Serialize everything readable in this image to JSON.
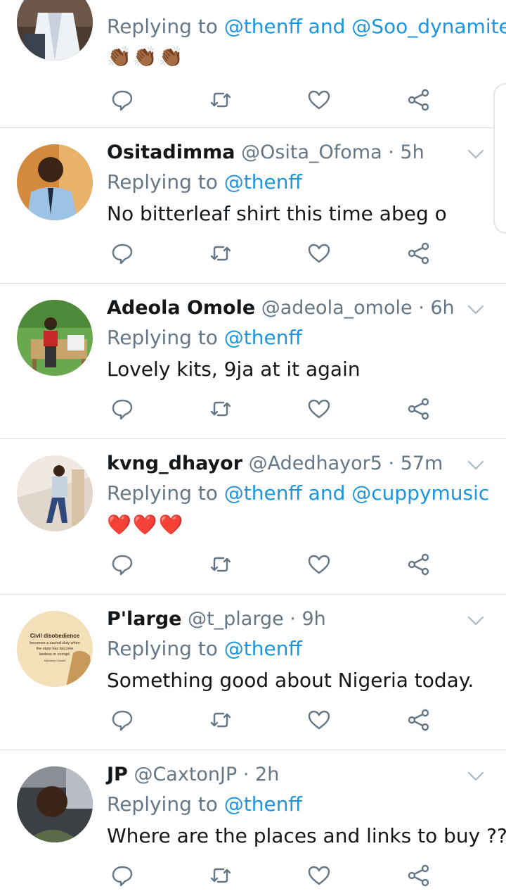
{
  "tweets": [
    {
      "name": "",
      "handle": "",
      "time": "",
      "reply_prefix": "Replying to",
      "mentions": [
        "@thenff",
        "and",
        "@Soo_dynamite"
      ],
      "body": "👏🏾👏🏾👏🏾",
      "is_emoji": true
    },
    {
      "name": "Ositadimma",
      "handle": "@Osita_Ofoma",
      "time": "· 5h",
      "reply_prefix": "Replying to",
      "mentions": [
        "@thenff"
      ],
      "body": "No bitterleaf shirt this time abeg o",
      "is_emoji": false
    },
    {
      "name": "Adeola Omole",
      "handle": "@adeola_omole",
      "time": "· 6h",
      "reply_prefix": "Replying to",
      "mentions": [
        "@thenff"
      ],
      "body": "Lovely kits, 9ja at it again",
      "is_emoji": false
    },
    {
      "name": "kvng_dhayor",
      "handle": "@Adedhayor5",
      "time": "· 57m",
      "reply_prefix": "Replying to",
      "mentions": [
        "@thenff",
        "and",
        "@cuppymusic"
      ],
      "body": "❤️❤️❤️",
      "is_emoji": true
    },
    {
      "name": "P'large",
      "handle": "@t_plarge",
      "time": "· 9h",
      "reply_prefix": "Replying to",
      "mentions": [
        "@thenff"
      ],
      "body": "Something good about Nigeria today.",
      "is_emoji": false
    },
    {
      "name": "JP",
      "handle": "@CaxtonJP",
      "time": "· 2h",
      "reply_prefix": "Replying to",
      "mentions": [
        "@thenff"
      ],
      "body": "Where are the places and links to buy ??",
      "is_emoji": false
    }
  ],
  "avatar5_text": {
    "line1": "Civil disobedience",
    "line2": "becomes a sacred duty when",
    "line3": "the state has become",
    "line4": "lawless or corrupt.",
    "line5": "Mahatma Gandhi"
  },
  "icons": {
    "reply": "reply-icon",
    "retweet": "retweet-icon",
    "like": "like-icon",
    "share": "share-icon",
    "caret": "chevron-down-icon"
  },
  "colors": {
    "link": "#1b95e0",
    "muted": "#657786",
    "text": "#14171a",
    "divider": "#d7dce0"
  }
}
